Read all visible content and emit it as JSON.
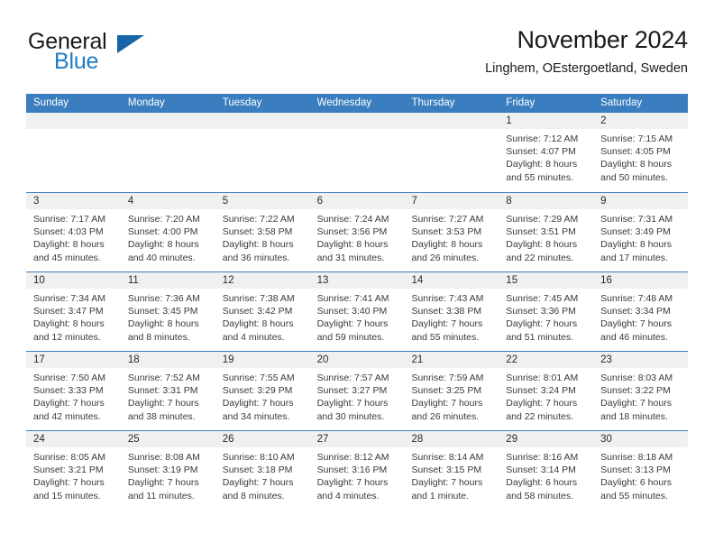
{
  "brand": {
    "word_one": "General",
    "word_two": "Blue",
    "logo_icon": "triangle-icon",
    "color_primary": "#1f7bc4",
    "color_triangle": "#1565a8"
  },
  "header": {
    "title": "November 2024",
    "subtitle": "Linghem, OEstergoetland, Sweden"
  },
  "calendar": {
    "accent_color": "#3a7ebf",
    "daynumber_band_color": "#f0f0f0",
    "weekdays": [
      "Sunday",
      "Monday",
      "Tuesday",
      "Wednesday",
      "Thursday",
      "Friday",
      "Saturday"
    ],
    "weeks": [
      [
        {
          "day": "",
          "empty": true
        },
        {
          "day": "",
          "empty": true
        },
        {
          "day": "",
          "empty": true
        },
        {
          "day": "",
          "empty": true
        },
        {
          "day": "",
          "empty": true
        },
        {
          "day": "1",
          "sunrise": "Sunrise: 7:12 AM",
          "sunset": "Sunset: 4:07 PM",
          "daylight_line1": "Daylight: 8 hours",
          "daylight_line2": "and 55 minutes."
        },
        {
          "day": "2",
          "sunrise": "Sunrise: 7:15 AM",
          "sunset": "Sunset: 4:05 PM",
          "daylight_line1": "Daylight: 8 hours",
          "daylight_line2": "and 50 minutes."
        }
      ],
      [
        {
          "day": "3",
          "sunrise": "Sunrise: 7:17 AM",
          "sunset": "Sunset: 4:03 PM",
          "daylight_line1": "Daylight: 8 hours",
          "daylight_line2": "and 45 minutes."
        },
        {
          "day": "4",
          "sunrise": "Sunrise: 7:20 AM",
          "sunset": "Sunset: 4:00 PM",
          "daylight_line1": "Daylight: 8 hours",
          "daylight_line2": "and 40 minutes."
        },
        {
          "day": "5",
          "sunrise": "Sunrise: 7:22 AM",
          "sunset": "Sunset: 3:58 PM",
          "daylight_line1": "Daylight: 8 hours",
          "daylight_line2": "and 36 minutes."
        },
        {
          "day": "6",
          "sunrise": "Sunrise: 7:24 AM",
          "sunset": "Sunset: 3:56 PM",
          "daylight_line1": "Daylight: 8 hours",
          "daylight_line2": "and 31 minutes."
        },
        {
          "day": "7",
          "sunrise": "Sunrise: 7:27 AM",
          "sunset": "Sunset: 3:53 PM",
          "daylight_line1": "Daylight: 8 hours",
          "daylight_line2": "and 26 minutes."
        },
        {
          "day": "8",
          "sunrise": "Sunrise: 7:29 AM",
          "sunset": "Sunset: 3:51 PM",
          "daylight_line1": "Daylight: 8 hours",
          "daylight_line2": "and 22 minutes."
        },
        {
          "day": "9",
          "sunrise": "Sunrise: 7:31 AM",
          "sunset": "Sunset: 3:49 PM",
          "daylight_line1": "Daylight: 8 hours",
          "daylight_line2": "and 17 minutes."
        }
      ],
      [
        {
          "day": "10",
          "sunrise": "Sunrise: 7:34 AM",
          "sunset": "Sunset: 3:47 PM",
          "daylight_line1": "Daylight: 8 hours",
          "daylight_line2": "and 12 minutes."
        },
        {
          "day": "11",
          "sunrise": "Sunrise: 7:36 AM",
          "sunset": "Sunset: 3:45 PM",
          "daylight_line1": "Daylight: 8 hours",
          "daylight_line2": "and 8 minutes."
        },
        {
          "day": "12",
          "sunrise": "Sunrise: 7:38 AM",
          "sunset": "Sunset: 3:42 PM",
          "daylight_line1": "Daylight: 8 hours",
          "daylight_line2": "and 4 minutes."
        },
        {
          "day": "13",
          "sunrise": "Sunrise: 7:41 AM",
          "sunset": "Sunset: 3:40 PM",
          "daylight_line1": "Daylight: 7 hours",
          "daylight_line2": "and 59 minutes."
        },
        {
          "day": "14",
          "sunrise": "Sunrise: 7:43 AM",
          "sunset": "Sunset: 3:38 PM",
          "daylight_line1": "Daylight: 7 hours",
          "daylight_line2": "and 55 minutes."
        },
        {
          "day": "15",
          "sunrise": "Sunrise: 7:45 AM",
          "sunset": "Sunset: 3:36 PM",
          "daylight_line1": "Daylight: 7 hours",
          "daylight_line2": "and 51 minutes."
        },
        {
          "day": "16",
          "sunrise": "Sunrise: 7:48 AM",
          "sunset": "Sunset: 3:34 PM",
          "daylight_line1": "Daylight: 7 hours",
          "daylight_line2": "and 46 minutes."
        }
      ],
      [
        {
          "day": "17",
          "sunrise": "Sunrise: 7:50 AM",
          "sunset": "Sunset: 3:33 PM",
          "daylight_line1": "Daylight: 7 hours",
          "daylight_line2": "and 42 minutes."
        },
        {
          "day": "18",
          "sunrise": "Sunrise: 7:52 AM",
          "sunset": "Sunset: 3:31 PM",
          "daylight_line1": "Daylight: 7 hours",
          "daylight_line2": "and 38 minutes."
        },
        {
          "day": "19",
          "sunrise": "Sunrise: 7:55 AM",
          "sunset": "Sunset: 3:29 PM",
          "daylight_line1": "Daylight: 7 hours",
          "daylight_line2": "and 34 minutes."
        },
        {
          "day": "20",
          "sunrise": "Sunrise: 7:57 AM",
          "sunset": "Sunset: 3:27 PM",
          "daylight_line1": "Daylight: 7 hours",
          "daylight_line2": "and 30 minutes."
        },
        {
          "day": "21",
          "sunrise": "Sunrise: 7:59 AM",
          "sunset": "Sunset: 3:25 PM",
          "daylight_line1": "Daylight: 7 hours",
          "daylight_line2": "and 26 minutes."
        },
        {
          "day": "22",
          "sunrise": "Sunrise: 8:01 AM",
          "sunset": "Sunset: 3:24 PM",
          "daylight_line1": "Daylight: 7 hours",
          "daylight_line2": "and 22 minutes."
        },
        {
          "day": "23",
          "sunrise": "Sunrise: 8:03 AM",
          "sunset": "Sunset: 3:22 PM",
          "daylight_line1": "Daylight: 7 hours",
          "daylight_line2": "and 18 minutes."
        }
      ],
      [
        {
          "day": "24",
          "sunrise": "Sunrise: 8:05 AM",
          "sunset": "Sunset: 3:21 PM",
          "daylight_line1": "Daylight: 7 hours",
          "daylight_line2": "and 15 minutes."
        },
        {
          "day": "25",
          "sunrise": "Sunrise: 8:08 AM",
          "sunset": "Sunset: 3:19 PM",
          "daylight_line1": "Daylight: 7 hours",
          "daylight_line2": "and 11 minutes."
        },
        {
          "day": "26",
          "sunrise": "Sunrise: 8:10 AM",
          "sunset": "Sunset: 3:18 PM",
          "daylight_line1": "Daylight: 7 hours",
          "daylight_line2": "and 8 minutes."
        },
        {
          "day": "27",
          "sunrise": "Sunrise: 8:12 AM",
          "sunset": "Sunset: 3:16 PM",
          "daylight_line1": "Daylight: 7 hours",
          "daylight_line2": "and 4 minutes."
        },
        {
          "day": "28",
          "sunrise": "Sunrise: 8:14 AM",
          "sunset": "Sunset: 3:15 PM",
          "daylight_line1": "Daylight: 7 hours",
          "daylight_line2": "and 1 minute."
        },
        {
          "day": "29",
          "sunrise": "Sunrise: 8:16 AM",
          "sunset": "Sunset: 3:14 PM",
          "daylight_line1": "Daylight: 6 hours",
          "daylight_line2": "and 58 minutes."
        },
        {
          "day": "30",
          "sunrise": "Sunrise: 8:18 AM",
          "sunset": "Sunset: 3:13 PM",
          "daylight_line1": "Daylight: 6 hours",
          "daylight_line2": "and 55 minutes."
        }
      ]
    ]
  }
}
